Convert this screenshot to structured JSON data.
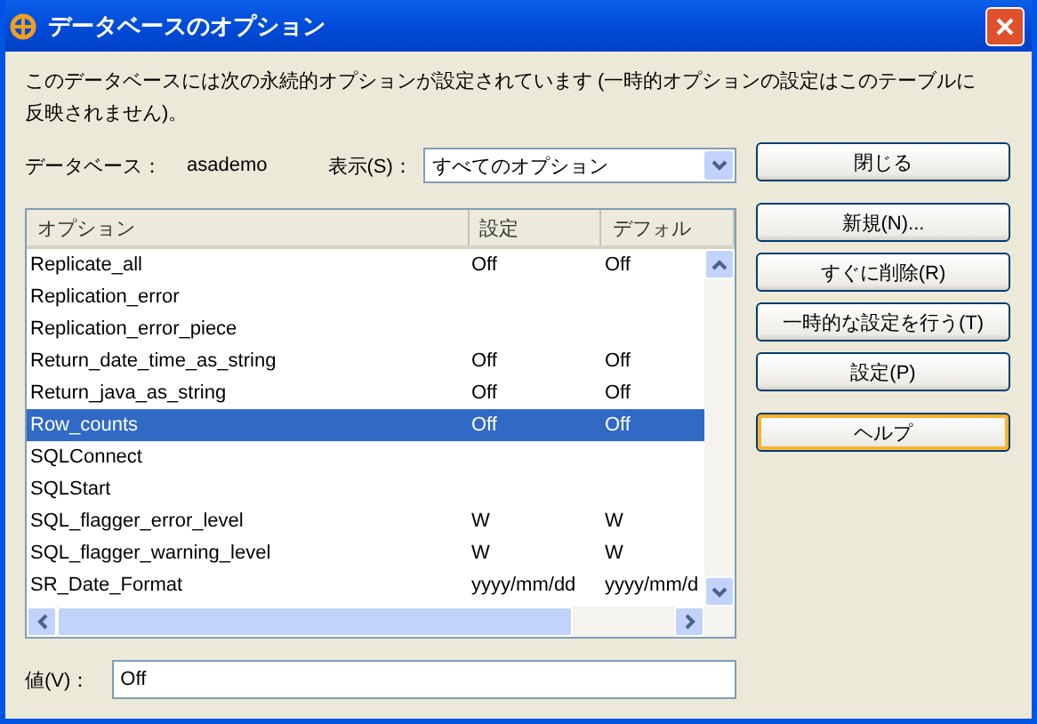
{
  "window": {
    "title": "データベースのオプション"
  },
  "description": "このデータベースには次の永続的オプションが設定されています (一時的オプションの設定はこのテーブルに反映されません)。",
  "database": {
    "label": "データベース：",
    "value": "asademo"
  },
  "display": {
    "label": "表示(S)：",
    "value": "すべてのオプション"
  },
  "table": {
    "columns": [
      "オプション",
      "設定",
      "デフォル"
    ],
    "rows": [
      {
        "cells": [
          "Replicate_all",
          "Off",
          "Off"
        ],
        "selected": false
      },
      {
        "cells": [
          "Replication_error",
          "",
          ""
        ],
        "selected": false
      },
      {
        "cells": [
          "Replication_error_piece",
          "",
          ""
        ],
        "selected": false
      },
      {
        "cells": [
          "Return_date_time_as_string",
          "Off",
          "Off"
        ],
        "selected": false
      },
      {
        "cells": [
          "Return_java_as_string",
          "Off",
          "Off"
        ],
        "selected": false
      },
      {
        "cells": [
          "Row_counts",
          "Off",
          "Off"
        ],
        "selected": true
      },
      {
        "cells": [
          "SQLConnect",
          "",
          ""
        ],
        "selected": false
      },
      {
        "cells": [
          "SQLStart",
          "",
          ""
        ],
        "selected": false
      },
      {
        "cells": [
          "SQL_flagger_error_level",
          "W",
          "W"
        ],
        "selected": false
      },
      {
        "cells": [
          "SQL_flagger_warning_level",
          "W",
          "W"
        ],
        "selected": false
      },
      {
        "cells": [
          "SR_Date_Format",
          "yyyy/mm/dd",
          "yyyy/mm/d"
        ],
        "selected": false
      }
    ]
  },
  "value": {
    "label": "値(V)：",
    "value": "Off"
  },
  "buttons": [
    {
      "label": "閉じる",
      "focused": false
    },
    {
      "label": "新規(N)...",
      "focused": false
    },
    {
      "label": "すぐに削除(R)",
      "focused": false
    },
    {
      "label": "一時的な設定を行う(T)",
      "focused": false
    },
    {
      "label": "設定(P)",
      "focused": false
    },
    {
      "label": "ヘルプ",
      "focused": true
    }
  ]
}
